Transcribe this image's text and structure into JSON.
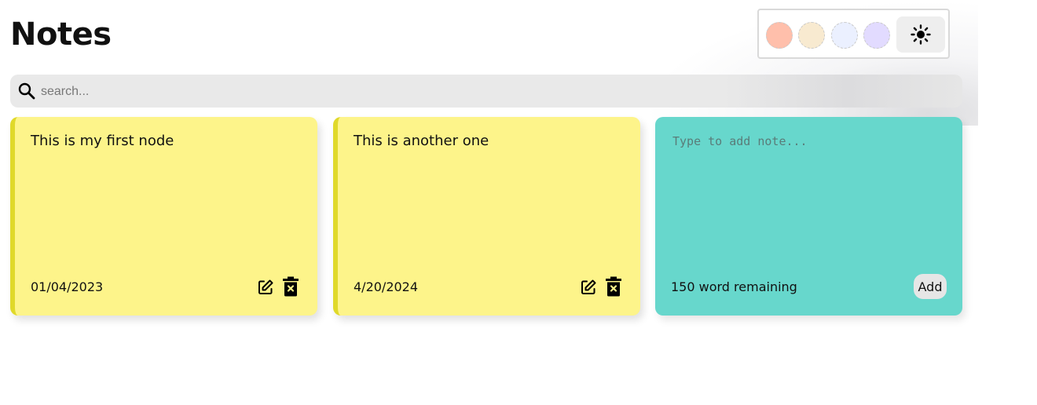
{
  "header": {
    "title": "Notes"
  },
  "palette": {
    "swatches": [
      {
        "name": "peach",
        "color": "#ffbfab"
      },
      {
        "name": "cream",
        "color": "#f8ead0"
      },
      {
        "name": "light-blue",
        "color": "#ebf0ff"
      },
      {
        "name": "lavender",
        "color": "#e2dbff"
      }
    ],
    "theme_icon": "sun-icon"
  },
  "search": {
    "placeholder": "search...",
    "value": "",
    "icon": "search-icon"
  },
  "notes": [
    {
      "text": "This is my first node",
      "date": "01/04/2023",
      "color": "#fdf48a",
      "edit_icon": "edit-icon",
      "delete_icon": "trash-icon"
    },
    {
      "text": "This is another one",
      "date": "4/20/2024",
      "color": "#fdf48a",
      "edit_icon": "edit-icon",
      "delete_icon": "trash-icon"
    }
  ],
  "new_note": {
    "placeholder": "Type to add note...",
    "value": "",
    "remaining_text": "150 word remaining",
    "add_label": "Add",
    "color": "#67d7cc"
  }
}
